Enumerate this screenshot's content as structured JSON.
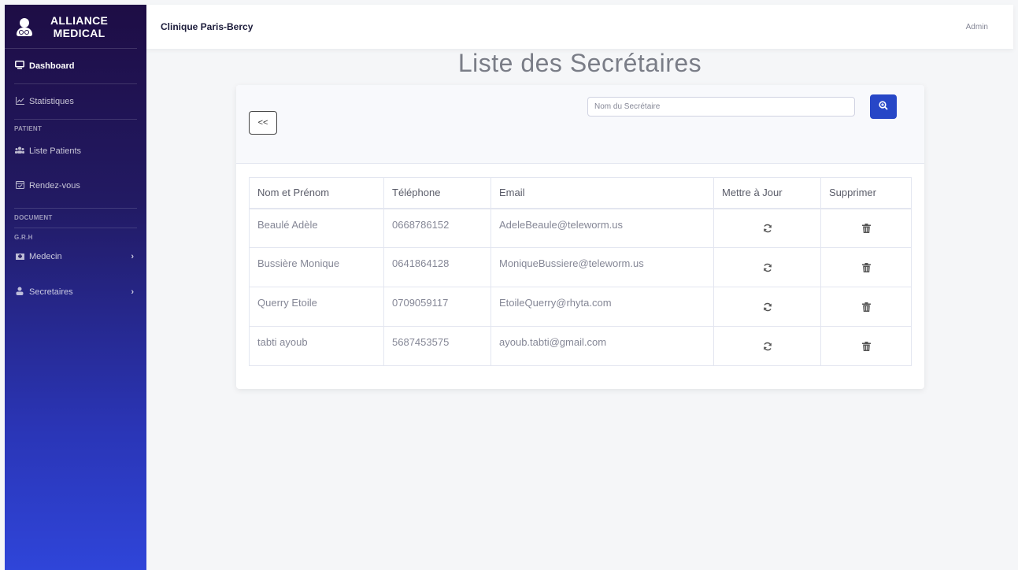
{
  "brand": {
    "line1": "ALLIANCE",
    "line2": "MEDICAL"
  },
  "sidebar": {
    "dashboard": "Dashboard",
    "statistiques": "Statistiques",
    "section_patient": "PATIENT",
    "liste_patients": "Liste Patients",
    "rendez_vous": "Rendez-vous",
    "section_document": "DOCUMENT",
    "section_grh": "G.R.H",
    "medecin": "Medecin",
    "secretaires": "Secretaires"
  },
  "topbar": {
    "clinic": "Clinique Paris-Bercy",
    "user": "Admin"
  },
  "page": {
    "title": "Liste des Secrétaires"
  },
  "toolbar": {
    "back_label": "<<",
    "search_placeholder": "Nom du Secrétaire"
  },
  "table": {
    "headers": [
      "Nom et Prénom",
      "Téléphone",
      "Email",
      "Mettre à Jour",
      "Supprimer"
    ],
    "rows": [
      {
        "name": "Beaulé Adèle",
        "phone": "0668786152",
        "email": "AdeleBeaule@teleworm.us"
      },
      {
        "name": "Bussière Monique",
        "phone": "0641864128",
        "email": "MoniqueBussiere@teleworm.us"
      },
      {
        "name": "Querry Etoile",
        "phone": "0709059117",
        "email": "EtoileQuerry@rhyta.com"
      },
      {
        "name": "tabti ayoub",
        "phone": "5687453575",
        "email": "ayoub.tabti@gmail.com"
      }
    ]
  },
  "colors": {
    "accent": "#2747c7",
    "sidebar_top": "#1e0d45",
    "sidebar_bottom": "#2f45d9"
  },
  "icons": [
    "user-doctor-icon",
    "monitor-icon",
    "chart-line-icon",
    "users-icon",
    "calendar-check-icon",
    "hospital-icon",
    "user-tie-icon",
    "search-plus-icon",
    "sync-icon",
    "trash-icon",
    "chevron-right-icon"
  ]
}
